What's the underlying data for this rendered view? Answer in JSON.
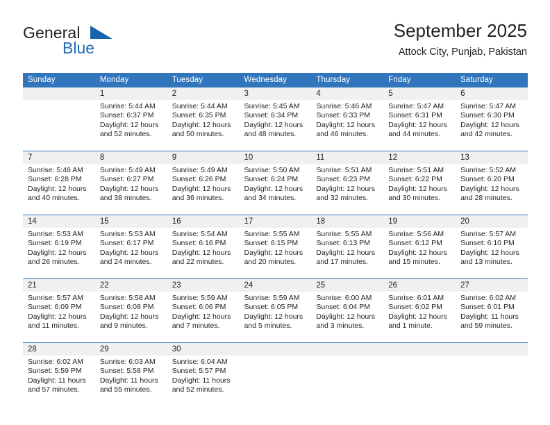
{
  "brand": {
    "name_part1": "General",
    "name_part2": "Blue",
    "triangle_color": "#1665ae",
    "blue_color": "#1f6cb4"
  },
  "header": {
    "month_title": "September 2025",
    "location": "Attock City, Punjab, Pakistan"
  },
  "theme": {
    "header_bg": "#3176bc",
    "daynum_bg": "#f0f0f0",
    "rule_color": "#3176bc",
    "text_color": "#231f20"
  },
  "calendar": {
    "weekday_headers": [
      "Sunday",
      "Monday",
      "Tuesday",
      "Wednesday",
      "Thursday",
      "Friday",
      "Saturday"
    ],
    "weeks": [
      {
        "days": [
          {
            "num": "",
            "sunrise": "",
            "sunset": "",
            "daylight_a": "",
            "daylight_b": ""
          },
          {
            "num": "1",
            "sunrise": "Sunrise: 5:44 AM",
            "sunset": "Sunset: 6:37 PM",
            "daylight_a": "Daylight: 12 hours",
            "daylight_b": "and 52 minutes."
          },
          {
            "num": "2",
            "sunrise": "Sunrise: 5:44 AM",
            "sunset": "Sunset: 6:35 PM",
            "daylight_a": "Daylight: 12 hours",
            "daylight_b": "and 50 minutes."
          },
          {
            "num": "3",
            "sunrise": "Sunrise: 5:45 AM",
            "sunset": "Sunset: 6:34 PM",
            "daylight_a": "Daylight: 12 hours",
            "daylight_b": "and 48 minutes."
          },
          {
            "num": "4",
            "sunrise": "Sunrise: 5:46 AM",
            "sunset": "Sunset: 6:33 PM",
            "daylight_a": "Daylight: 12 hours",
            "daylight_b": "and 46 minutes."
          },
          {
            "num": "5",
            "sunrise": "Sunrise: 5:47 AM",
            "sunset": "Sunset: 6:31 PM",
            "daylight_a": "Daylight: 12 hours",
            "daylight_b": "and 44 minutes."
          },
          {
            "num": "6",
            "sunrise": "Sunrise: 5:47 AM",
            "sunset": "Sunset: 6:30 PM",
            "daylight_a": "Daylight: 12 hours",
            "daylight_b": "and 42 minutes."
          }
        ]
      },
      {
        "days": [
          {
            "num": "7",
            "sunrise": "Sunrise: 5:48 AM",
            "sunset": "Sunset: 6:28 PM",
            "daylight_a": "Daylight: 12 hours",
            "daylight_b": "and 40 minutes."
          },
          {
            "num": "8",
            "sunrise": "Sunrise: 5:49 AM",
            "sunset": "Sunset: 6:27 PM",
            "daylight_a": "Daylight: 12 hours",
            "daylight_b": "and 38 minutes."
          },
          {
            "num": "9",
            "sunrise": "Sunrise: 5:49 AM",
            "sunset": "Sunset: 6:26 PM",
            "daylight_a": "Daylight: 12 hours",
            "daylight_b": "and 36 minutes."
          },
          {
            "num": "10",
            "sunrise": "Sunrise: 5:50 AM",
            "sunset": "Sunset: 6:24 PM",
            "daylight_a": "Daylight: 12 hours",
            "daylight_b": "and 34 minutes."
          },
          {
            "num": "11",
            "sunrise": "Sunrise: 5:51 AM",
            "sunset": "Sunset: 6:23 PM",
            "daylight_a": "Daylight: 12 hours",
            "daylight_b": "and 32 minutes."
          },
          {
            "num": "12",
            "sunrise": "Sunrise: 5:51 AM",
            "sunset": "Sunset: 6:22 PM",
            "daylight_a": "Daylight: 12 hours",
            "daylight_b": "and 30 minutes."
          },
          {
            "num": "13",
            "sunrise": "Sunrise: 5:52 AM",
            "sunset": "Sunset: 6:20 PM",
            "daylight_a": "Daylight: 12 hours",
            "daylight_b": "and 28 minutes."
          }
        ]
      },
      {
        "days": [
          {
            "num": "14",
            "sunrise": "Sunrise: 5:53 AM",
            "sunset": "Sunset: 6:19 PM",
            "daylight_a": "Daylight: 12 hours",
            "daylight_b": "and 26 minutes."
          },
          {
            "num": "15",
            "sunrise": "Sunrise: 5:53 AM",
            "sunset": "Sunset: 6:17 PM",
            "daylight_a": "Daylight: 12 hours",
            "daylight_b": "and 24 minutes."
          },
          {
            "num": "16",
            "sunrise": "Sunrise: 5:54 AM",
            "sunset": "Sunset: 6:16 PM",
            "daylight_a": "Daylight: 12 hours",
            "daylight_b": "and 22 minutes."
          },
          {
            "num": "17",
            "sunrise": "Sunrise: 5:55 AM",
            "sunset": "Sunset: 6:15 PM",
            "daylight_a": "Daylight: 12 hours",
            "daylight_b": "and 20 minutes."
          },
          {
            "num": "18",
            "sunrise": "Sunrise: 5:55 AM",
            "sunset": "Sunset: 6:13 PM",
            "daylight_a": "Daylight: 12 hours",
            "daylight_b": "and 17 minutes."
          },
          {
            "num": "19",
            "sunrise": "Sunrise: 5:56 AM",
            "sunset": "Sunset: 6:12 PM",
            "daylight_a": "Daylight: 12 hours",
            "daylight_b": "and 15 minutes."
          },
          {
            "num": "20",
            "sunrise": "Sunrise: 5:57 AM",
            "sunset": "Sunset: 6:10 PM",
            "daylight_a": "Daylight: 12 hours",
            "daylight_b": "and 13 minutes."
          }
        ]
      },
      {
        "days": [
          {
            "num": "21",
            "sunrise": "Sunrise: 5:57 AM",
            "sunset": "Sunset: 6:09 PM",
            "daylight_a": "Daylight: 12 hours",
            "daylight_b": "and 11 minutes."
          },
          {
            "num": "22",
            "sunrise": "Sunrise: 5:58 AM",
            "sunset": "Sunset: 6:08 PM",
            "daylight_a": "Daylight: 12 hours",
            "daylight_b": "and 9 minutes."
          },
          {
            "num": "23",
            "sunrise": "Sunrise: 5:59 AM",
            "sunset": "Sunset: 6:06 PM",
            "daylight_a": "Daylight: 12 hours",
            "daylight_b": "and 7 minutes."
          },
          {
            "num": "24",
            "sunrise": "Sunrise: 5:59 AM",
            "sunset": "Sunset: 6:05 PM",
            "daylight_a": "Daylight: 12 hours",
            "daylight_b": "and 5 minutes."
          },
          {
            "num": "25",
            "sunrise": "Sunrise: 6:00 AM",
            "sunset": "Sunset: 6:04 PM",
            "daylight_a": "Daylight: 12 hours",
            "daylight_b": "and 3 minutes."
          },
          {
            "num": "26",
            "sunrise": "Sunrise: 6:01 AM",
            "sunset": "Sunset: 6:02 PM",
            "daylight_a": "Daylight: 12 hours",
            "daylight_b": "and 1 minute."
          },
          {
            "num": "27",
            "sunrise": "Sunrise: 6:02 AM",
            "sunset": "Sunset: 6:01 PM",
            "daylight_a": "Daylight: 11 hours",
            "daylight_b": "and 59 minutes."
          }
        ]
      },
      {
        "days": [
          {
            "num": "28",
            "sunrise": "Sunrise: 6:02 AM",
            "sunset": "Sunset: 5:59 PM",
            "daylight_a": "Daylight: 11 hours",
            "daylight_b": "and 57 minutes."
          },
          {
            "num": "29",
            "sunrise": "Sunrise: 6:03 AM",
            "sunset": "Sunset: 5:58 PM",
            "daylight_a": "Daylight: 11 hours",
            "daylight_b": "and 55 minutes."
          },
          {
            "num": "30",
            "sunrise": "Sunrise: 6:04 AM",
            "sunset": "Sunset: 5:57 PM",
            "daylight_a": "Daylight: 11 hours",
            "daylight_b": "and 52 minutes."
          },
          {
            "num": "",
            "sunrise": "",
            "sunset": "",
            "daylight_a": "",
            "daylight_b": ""
          },
          {
            "num": "",
            "sunrise": "",
            "sunset": "",
            "daylight_a": "",
            "daylight_b": ""
          },
          {
            "num": "",
            "sunrise": "",
            "sunset": "",
            "daylight_a": "",
            "daylight_b": ""
          },
          {
            "num": "",
            "sunrise": "",
            "sunset": "",
            "daylight_a": "",
            "daylight_b": ""
          }
        ]
      }
    ]
  }
}
